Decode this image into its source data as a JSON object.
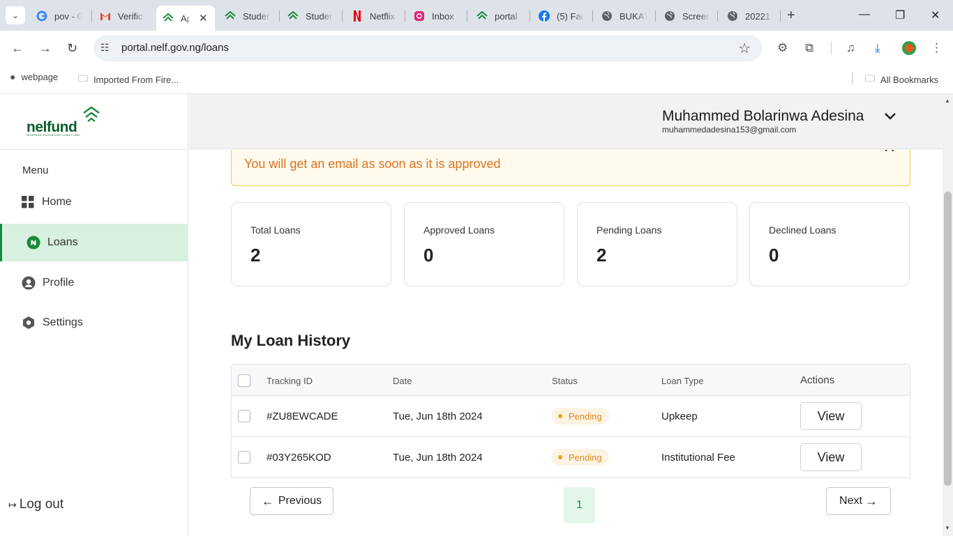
{
  "browser": {
    "tabs": [
      {
        "title": "pov - G",
        "icon": "google-icon"
      },
      {
        "title": "Verific",
        "icon": "gmail-icon"
      },
      {
        "title": "Ap",
        "icon": "nelfund-icon",
        "active": true
      },
      {
        "title": "Studer",
        "icon": "nelfund-icon"
      },
      {
        "title": "Studer",
        "icon": "nelfund-icon"
      },
      {
        "title": "Netflix",
        "icon": "netflix-icon"
      },
      {
        "title": "Inbox",
        "icon": "instagram-icon"
      },
      {
        "title": "portal",
        "icon": "nelfund-icon"
      },
      {
        "title": "(5) Fac",
        "icon": "facebook-icon"
      },
      {
        "title": "BUKAT",
        "icon": "globe-icon"
      },
      {
        "title": "Screen",
        "icon": "globe-icon"
      },
      {
        "title": "20221",
        "icon": "globe-icon"
      }
    ],
    "url": "portal.nelf.gov.ng/loans",
    "bookmarks": [
      {
        "label": "webpage",
        "icon": "globe-icon"
      },
      {
        "label": "Imported From Fire...",
        "icon": "folder-icon"
      }
    ],
    "all_bookmarks": "All Bookmarks"
  },
  "brand": {
    "name": "nelfund",
    "tagline": "NIGERIAN EDUCATION LOAN FUND"
  },
  "sidebar": {
    "menu_label": "Menu",
    "items": [
      {
        "label": "Home",
        "icon": "grid-icon"
      },
      {
        "label": "Loans",
        "icon": "naira-icon",
        "active": true
      },
      {
        "label": "Profile",
        "icon": "user-icon"
      },
      {
        "label": "Settings",
        "icon": "settings-icon"
      }
    ],
    "logout": "Log out"
  },
  "header": {
    "user_name": "Muhammed Bolarinwa Adesina",
    "user_email": "muhammedadesina153@gmail.com"
  },
  "alert": {
    "message": "You will get an email as soon as it is approved"
  },
  "stats": [
    {
      "label": "Total Loans",
      "value": "2"
    },
    {
      "label": "Approved Loans",
      "value": "0"
    },
    {
      "label": "Pending Loans",
      "value": "2"
    },
    {
      "label": "Declined Loans",
      "value": "0"
    }
  ],
  "history": {
    "title": "My Loan History",
    "columns": [
      "Tracking ID",
      "Date",
      "Status",
      "Loan Type",
      "Actions"
    ],
    "rows": [
      {
        "tracking_id": "#ZU8EWCADE",
        "date": "Tue, Jun 18th 2024",
        "status": "Pending",
        "loan_type": "Upkeep",
        "action": "View"
      },
      {
        "tracking_id": "#03Y265KOD",
        "date": "Tue, Jun 18th 2024",
        "status": "Pending",
        "loan_type": "Institutional Fee",
        "action": "View"
      }
    ],
    "pagination": {
      "previous": "Previous",
      "next": "Next",
      "page": "1"
    }
  },
  "colors": {
    "brand_green": "#1a8a3c",
    "alert_text": "#d97321",
    "pending": "#f0a020"
  }
}
